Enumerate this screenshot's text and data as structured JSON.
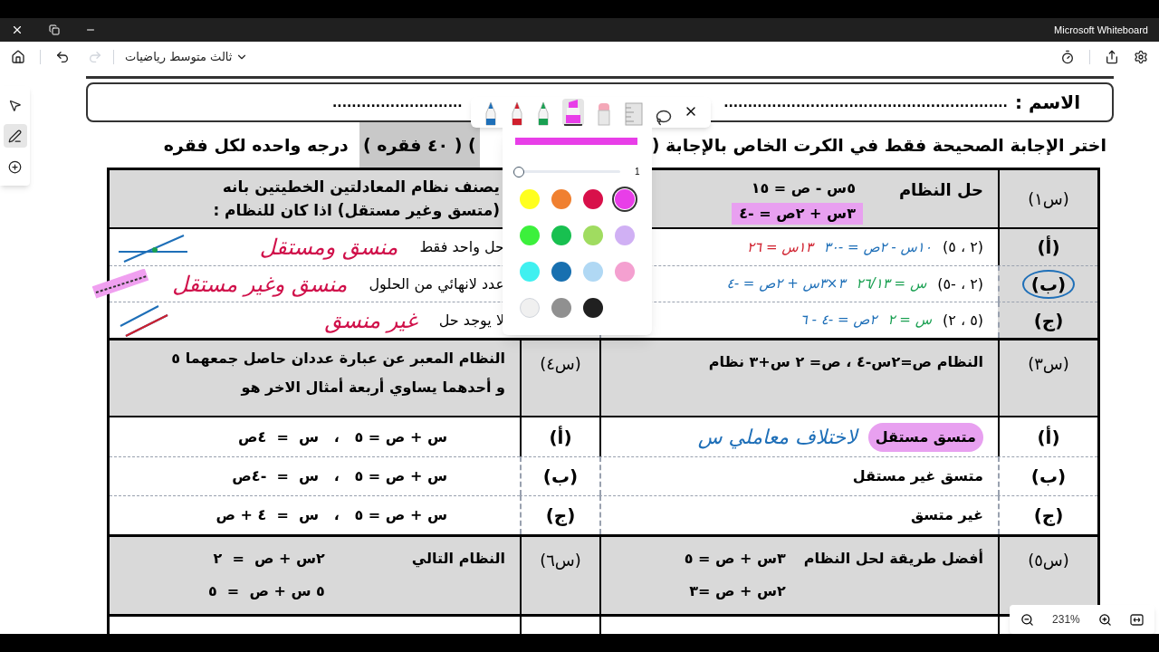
{
  "title_bar": {
    "app_name": "Microsoft Whiteboard"
  },
  "toolbar": {
    "board_name": "ثالث متوسط رياضيات",
    "redo_disabled": true
  },
  "side_tools": [
    {
      "kind": "select",
      "selected": false
    },
    {
      "kind": "pen",
      "selected": true
    },
    {
      "kind": "add",
      "selected": false
    }
  ],
  "document": {
    "name_label": "الاسم :",
    "name_dots_right": "...........................................................",
    "name_dots_left": "...........................",
    "instruction": [
      {
        "text": "اختر الإجابة الصحيحة فقط في الكرت الخاص بالإجابة (",
        "highlighted": false
      },
      {
        "text": ") ( ٤٠ فقره )",
        "highlighted": true
      },
      {
        "text": "درجه واحده لكل فقره",
        "highlighted": false
      }
    ],
    "q1": {
      "label": "(س١)",
      "prompt": "حل النظام",
      "equations": [
        {
          "text": "٥س - ص = ١٥",
          "highlighted": false
        },
        {
          "text": "٣س + ٢ص = -٤",
          "highlighted": true
        }
      ],
      "options": [
        {
          "label": "(أ)",
          "text": "(٢ ، ٥)",
          "circled": false,
          "work": [
            {
              "text": "١٠س - ٢ص = -٣٠",
              "color": "#1e6fb8"
            },
            {
              "text": "١٣س = ٢٦",
              "color": "#d0202e"
            }
          ]
        },
        {
          "label": "(ب)",
          "text": "(٢ ، -٥)",
          "circled": true,
          "work": [
            {
              "text": "س = ٢٦/١٣",
              "color": "#1aa052"
            },
            {
              "text": "٣×٣س + ٢ص = -٤",
              "color": "#1e6fb8"
            }
          ]
        },
        {
          "label": "(ج)",
          "text": "(٥ ، ٢)",
          "circled": false,
          "work": [
            {
              "text": "س = ٢",
              "color": "#1aa052"
            },
            {
              "text": "٢ص = -٤ - ٦",
              "color": "#1e6fb8"
            }
          ]
        }
      ]
    },
    "q2": {
      "prompt_lines": [
        "يصنف نظام المعادلتين الخطيتين بانه",
        "(متسق وغير مستقل)  اذا كان للنظام :"
      ],
      "options": [
        {
          "text": "حل واحد فقط",
          "note": "منسق ومستقل",
          "kind": "intersecting"
        },
        {
          "text": "عدد لانهائي من الحلول",
          "note": "منسق وغير مستقل",
          "kind": "coincident"
        },
        {
          "text": "لا يوجد حل",
          "note": "غير منسق",
          "kind": "parallel"
        }
      ]
    },
    "q3": {
      "label": "(س٣)",
      "prompt": "النظام   ص=٢س-٤ ، ص= ٢ س+٣ نظام",
      "options": [
        {
          "label": "(أ)",
          "text": "متسق مستقل",
          "highlighted": true,
          "note": "لاختلاف معاملي س"
        },
        {
          "label": "(ب)",
          "text": "متسق غير مستقل",
          "highlighted": false
        },
        {
          "label": "(ج)",
          "text": "غير متسق",
          "highlighted": false
        }
      ]
    },
    "q4": {
      "label": "(س٤)",
      "prompt_lines": [
        "النظام المعبر عن عبارة  عددان حاصل جمعهما ٥",
        "و أحدهما يساوي أربعة أمثال الاخر هو"
      ],
      "options": [
        {
          "label": "(أ)",
          "text": "س + ص = ٥   ،   س  =  ٤ص"
        },
        {
          "label": "(ب)",
          "text": "س + ص = ٥   ،   س  =  -٤ص"
        },
        {
          "label": "(ج)",
          "text": "س + ص = ٥   ،   س  =  ٤ + ص"
        }
      ]
    },
    "q5": {
      "label": "(س٥)",
      "prompt": "أفضل طريقة لحل النظام",
      "equations": [
        "٣س + ص = ٥",
        "٢س + ص =٣"
      ]
    },
    "q6": {
      "label": "(س٦)",
      "prompt": "النظام التالي",
      "equations": [
        "٢س + ص  =  ٢",
        "٥ س + ص  =  ٥"
      ]
    }
  },
  "pen_toolbar": {
    "tools": [
      {
        "kind": "pen",
        "color": "#1e6fb8",
        "selected": false
      },
      {
        "kind": "pen",
        "color": "#d0202e",
        "selected": false
      },
      {
        "kind": "pen",
        "color": "#1aa052",
        "selected": false
      },
      {
        "kind": "highlighter",
        "color": "#e83ee8",
        "selected": true
      },
      {
        "kind": "eraser",
        "selected": false
      },
      {
        "kind": "ruler",
        "selected": false
      },
      {
        "kind": "lasso",
        "selected": false
      }
    ]
  },
  "color_palette": {
    "level": 0,
    "size_label": "1",
    "colors": [
      {
        "color": "#ffff1f",
        "selected": false
      },
      {
        "color": "#f08030",
        "selected": false
      },
      {
        "color": "#d8104a",
        "selected": false
      },
      {
        "color": "#e83ee8",
        "selected": true
      },
      {
        "color": "#3cf03c",
        "selected": false
      },
      {
        "color": "#18c050",
        "selected": false
      },
      {
        "color": "#a0dc60",
        "selected": false
      },
      {
        "color": "#d0b0f4",
        "selected": false
      },
      {
        "color": "#40f0f0",
        "selected": false
      },
      {
        "color": "#1870b0",
        "selected": false
      },
      {
        "color": "#b0d8f4",
        "selected": false
      },
      {
        "color": "#f4a0d0",
        "selected": false
      },
      {
        "color": "#f0f0f0",
        "selected": false
      },
      {
        "color": "#909090",
        "selected": false
      },
      {
        "color": "#202020",
        "selected": false
      }
    ]
  },
  "zoom": {
    "value": "231%"
  }
}
